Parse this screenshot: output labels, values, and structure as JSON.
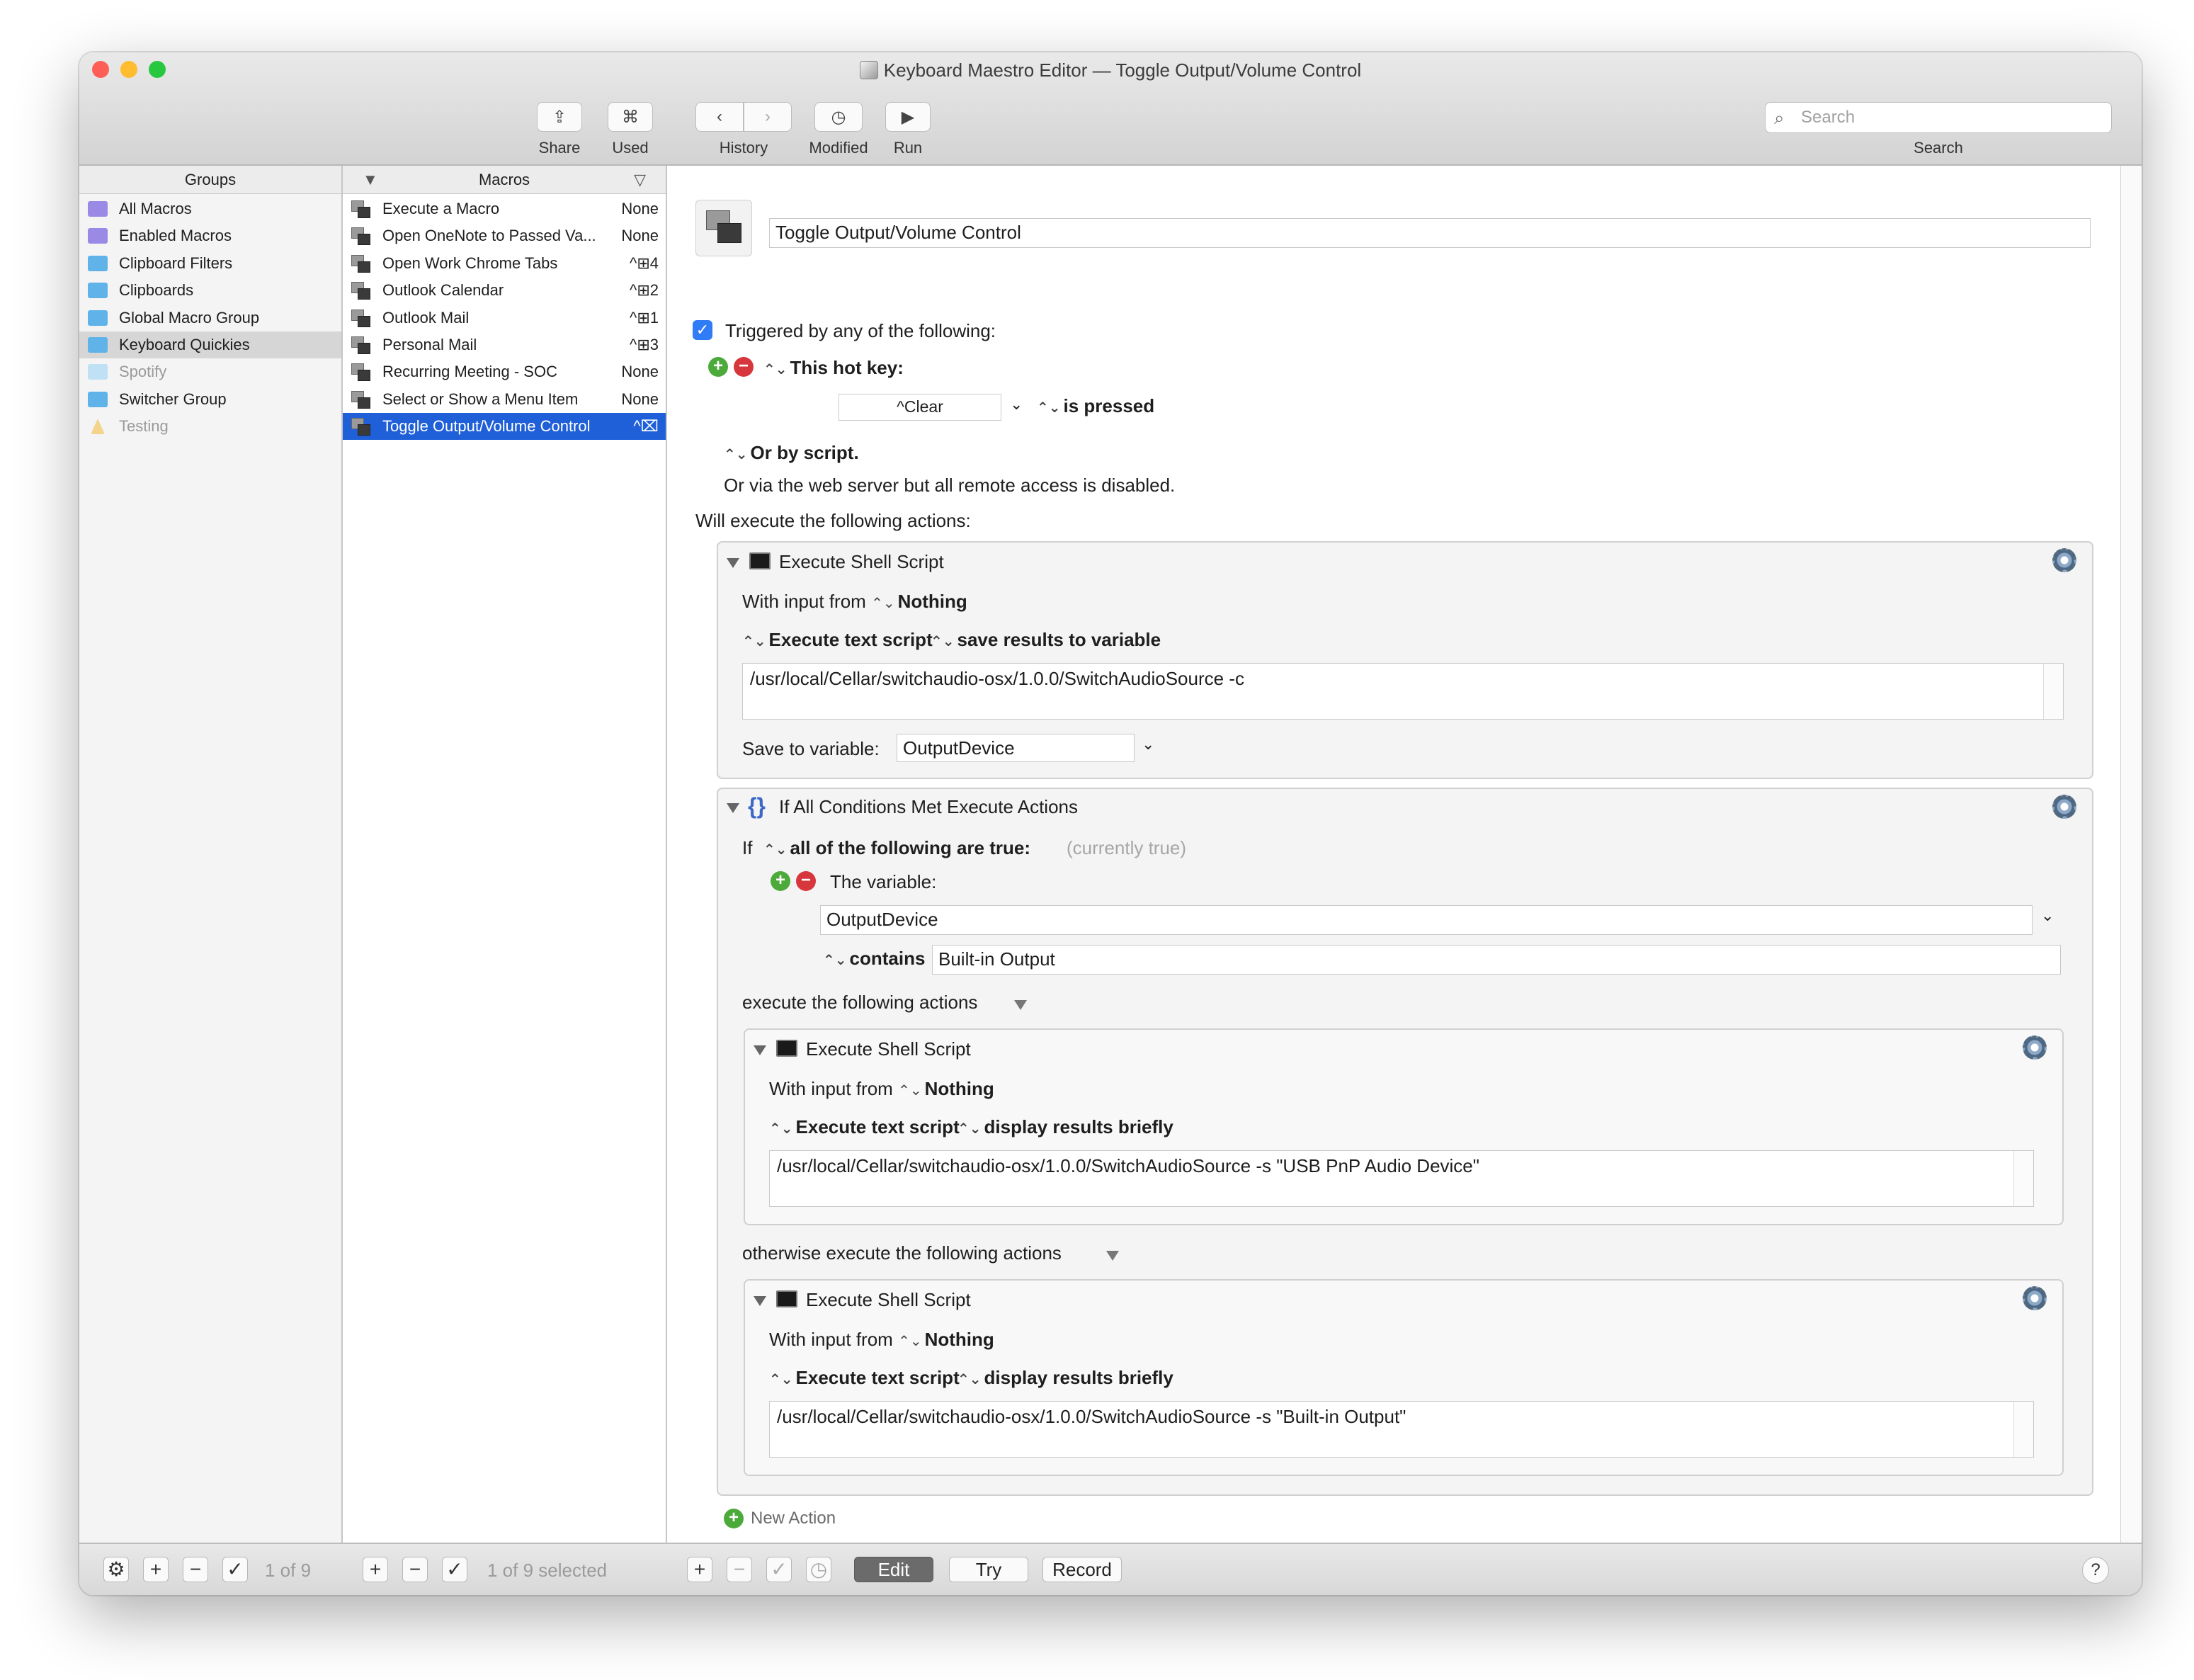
{
  "window": {
    "title": "Keyboard Maestro Editor — Toggle Output/Volume Control",
    "traffic": {
      "close": "#fd5f57",
      "minimize": "#febc2e",
      "zoom": "#27c840"
    }
  },
  "toolbar": {
    "share": "Share",
    "used": "Used",
    "history": "History",
    "modified": "Modified",
    "run": "Run",
    "search_label": "Search",
    "search_placeholder": "Search"
  },
  "groups": {
    "header": "Groups",
    "items": [
      {
        "label": "All Macros",
        "icon": "smart-group-icon",
        "color": "#9a8ae6"
      },
      {
        "label": "Enabled Macros",
        "icon": "smart-group-icon",
        "color": "#9a8ae6"
      },
      {
        "label": "Clipboard Filters",
        "icon": "folder-icon",
        "color": "#5fb3e8"
      },
      {
        "label": "Clipboards",
        "icon": "folder-icon",
        "color": "#5fb3e8"
      },
      {
        "label": "Global Macro Group",
        "icon": "folder-icon",
        "color": "#5fb3e8"
      },
      {
        "label": "Keyboard Quickies",
        "icon": "folder-icon",
        "color": "#5fb3e8"
      },
      {
        "label": "Spotify",
        "icon": "folder-icon",
        "color": "#bfe0f5"
      },
      {
        "label": "Switcher Group",
        "icon": "folder-icon",
        "color": "#5fb3e8"
      },
      {
        "label": "Testing",
        "icon": "warning-icon",
        "color": "#f4d48b"
      }
    ]
  },
  "macros": {
    "header": "Macros",
    "items": [
      {
        "label": "Execute a Macro",
        "key": "None"
      },
      {
        "label": "Open OneNote to Passed Va...",
        "key": "None"
      },
      {
        "label": "Open Work Chrome Tabs",
        "key": "^⊞4"
      },
      {
        "label": "Outlook Calendar",
        "key": "^⊞2"
      },
      {
        "label": "Outlook Mail",
        "key": "^⊞1"
      },
      {
        "label": "Personal Mail",
        "key": "^⊞3"
      },
      {
        "label": "Recurring Meeting - SOC",
        "key": "None"
      },
      {
        "label": "Select or Show a Menu Item",
        "key": "None"
      },
      {
        "label": "Toggle Output/Volume Control",
        "key": "^⌧"
      }
    ]
  },
  "editor": {
    "macro_name": "Toggle Output/Volume Control",
    "triggered_label": "Triggered by any of the following:",
    "hotkey_label": "This hot key:",
    "hotkey_value": "^Clear",
    "is_pressed": "is pressed",
    "or_by_script": "Or by script.",
    "web_server": "Or via the web server but all remote access is disabled.",
    "will_execute": "Will execute the following actions:",
    "action1": {
      "title": "Execute Shell Script",
      "with_input": "With input from",
      "input_value": "Nothing",
      "mode": "Execute text script",
      "result": "save results to variable",
      "script": "/usr/local/Cellar/switchaudio-osx/1.0.0/SwitchAudioSource -c",
      "save_label": "Save to variable:",
      "save_value": "OutputDevice"
    },
    "if_action": {
      "title": "If All Conditions Met Execute Actions",
      "if_word": "If",
      "all_true": "all of the following are true:",
      "currently": "(currently true)",
      "variable_label": "The variable:",
      "variable_value": "OutputDevice",
      "contains": "contains",
      "contains_value": "Built-in Output",
      "execute_label": "execute the following actions",
      "otherwise_label": "otherwise execute the following actions",
      "then_action": {
        "title": "Execute Shell Script",
        "with_input": "With input from",
        "input_value": "Nothing",
        "mode": "Execute text script",
        "result": "display results briefly",
        "script": "/usr/local/Cellar/switchaudio-osx/1.0.0/SwitchAudioSource -s \"USB PnP Audio Device\""
      },
      "else_action": {
        "title": "Execute Shell Script",
        "with_input": "With input from",
        "input_value": "Nothing",
        "mode": "Execute text script",
        "result": "display results briefly",
        "script": "/usr/local/Cellar/switchaudio-osx/1.0.0/SwitchAudioSource -s \"Built-in Output\""
      }
    },
    "new_action": "New Action"
  },
  "bottom": {
    "groups_count": "1 of 9",
    "macros_count": "1 of 9 selected",
    "edit": "Edit",
    "try": "Try",
    "record": "Record",
    "help": "?"
  },
  "colors": {
    "selection": "#1f5fd8",
    "group_selection": "#d6d6d6",
    "accent": "#2f7cf6"
  }
}
